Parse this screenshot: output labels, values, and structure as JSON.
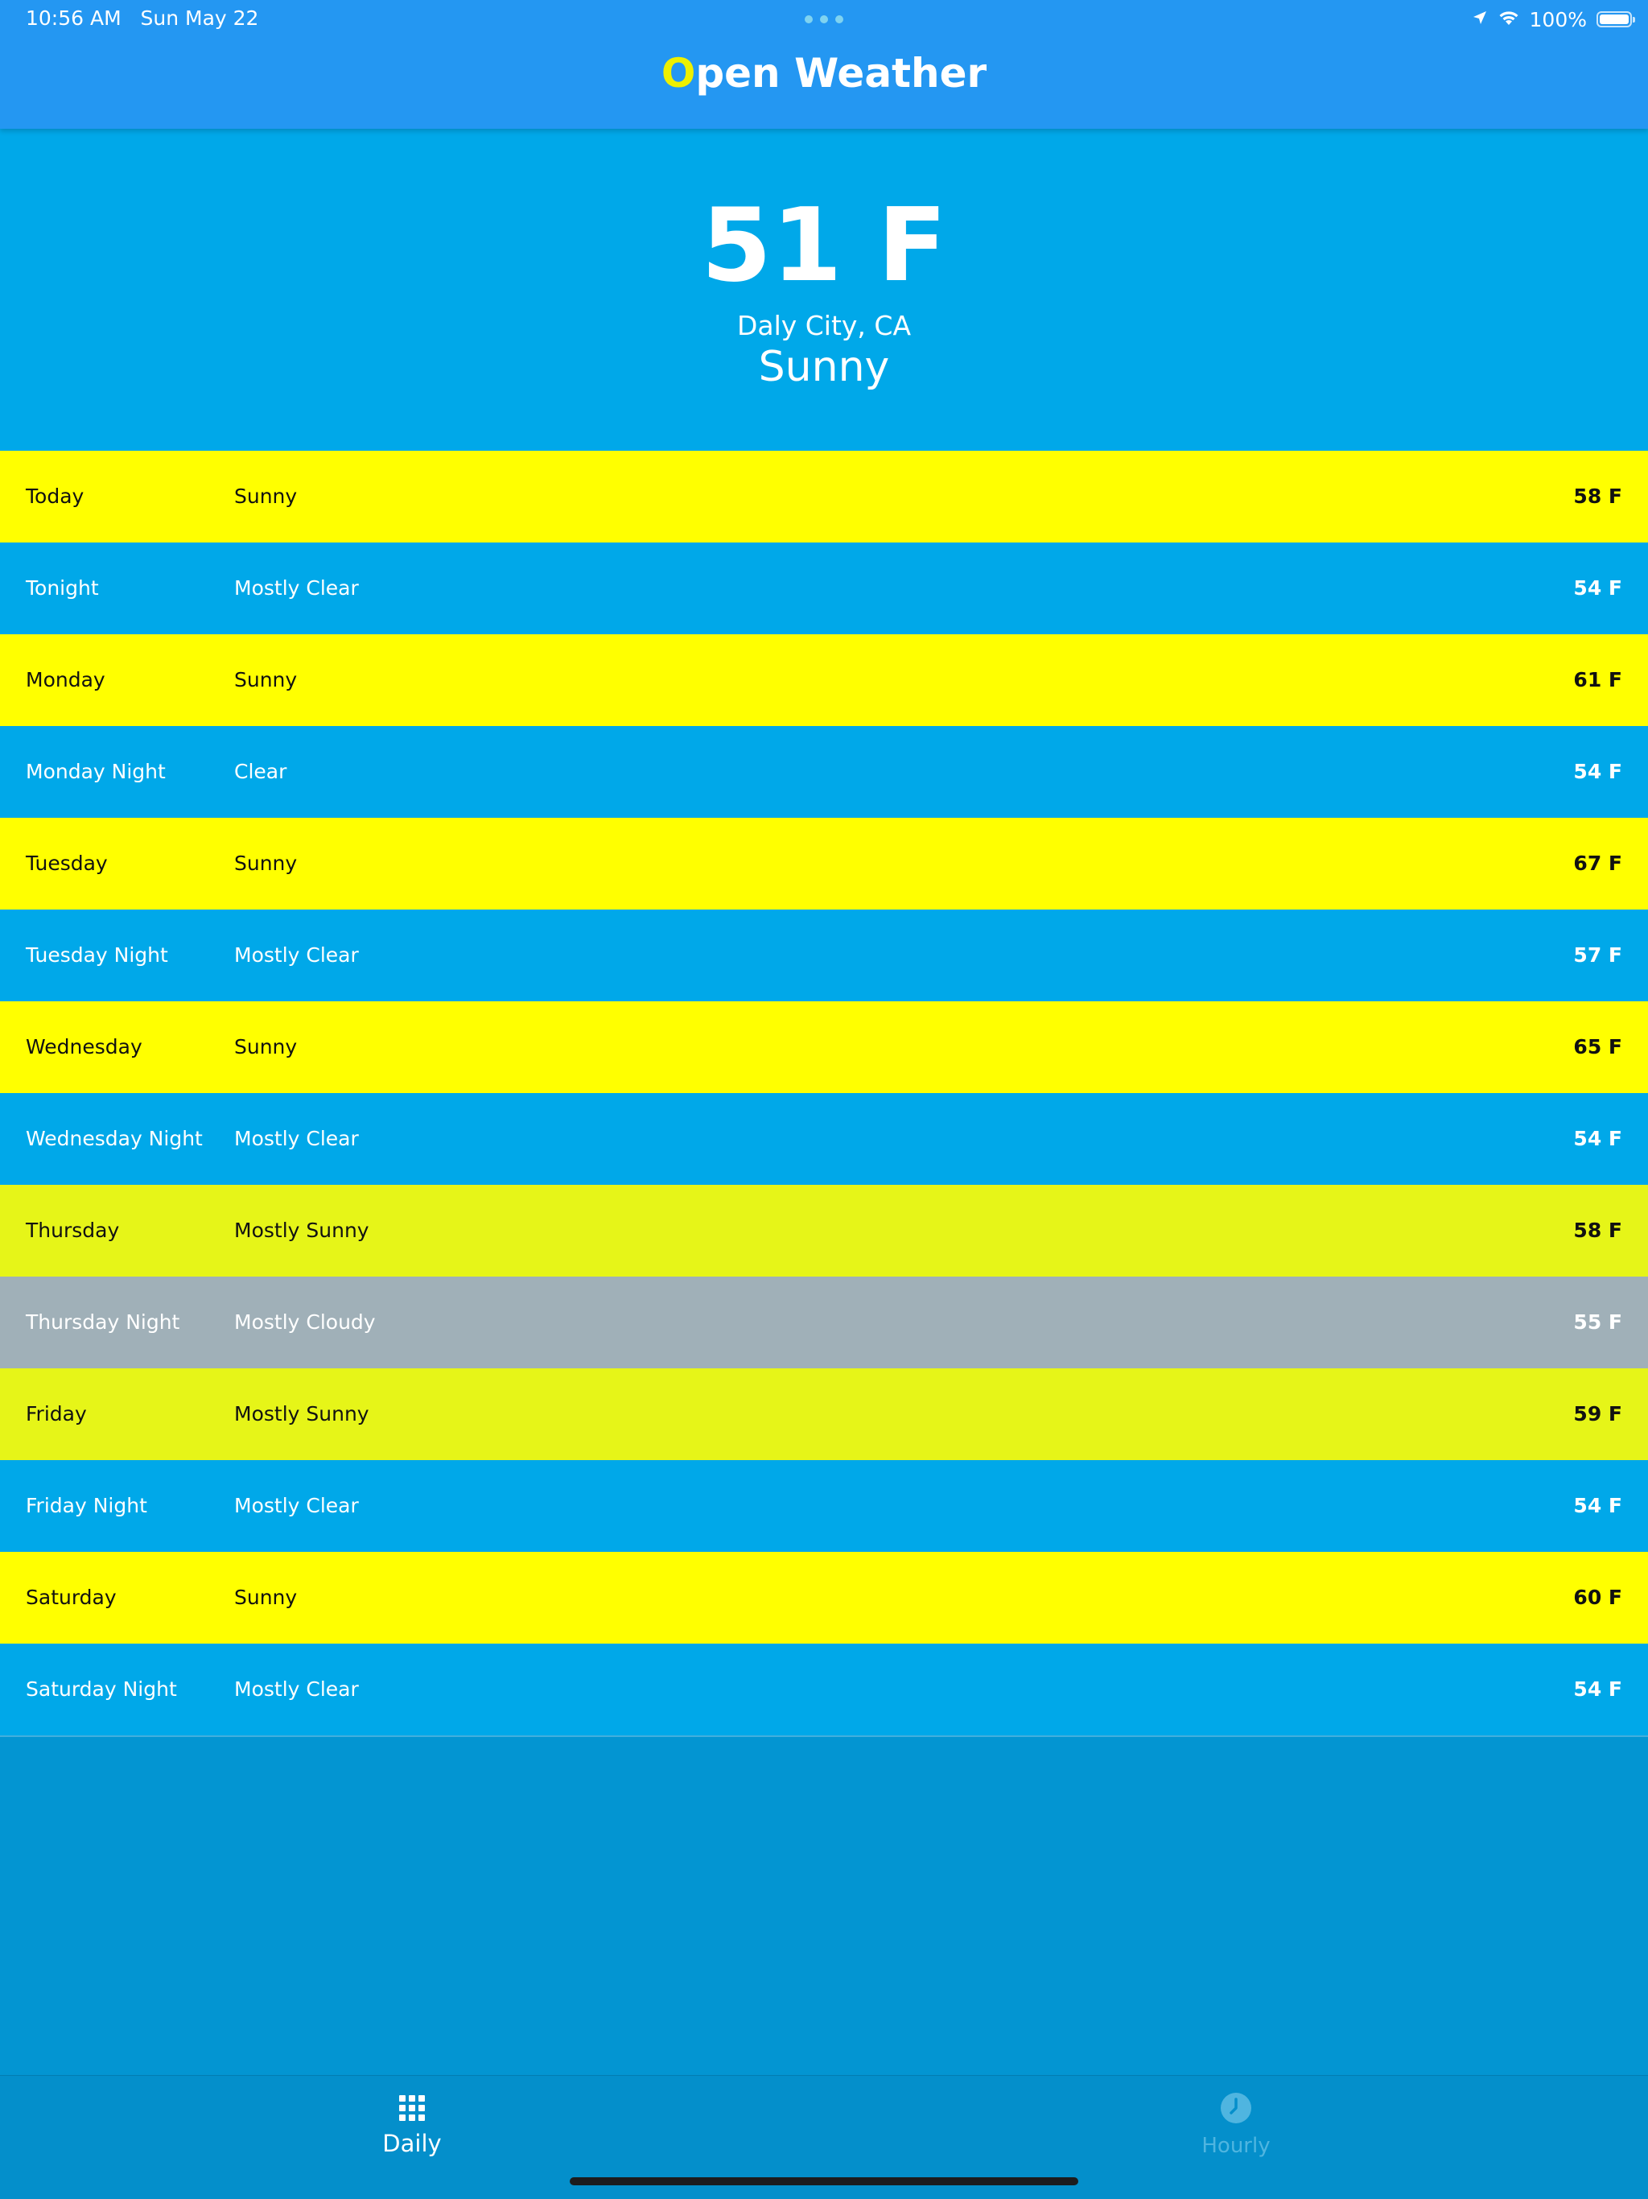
{
  "status_bar": {
    "time": "10:56 AM   Sun May 22",
    "battery": "100%"
  },
  "header": {
    "title_first_letter": "O",
    "title_rest": "pen Weather",
    "accent_color": "#eef000",
    "bar_color": "#2497f2"
  },
  "current": {
    "temperature": "51 F",
    "location": "Daly City, CA",
    "condition": "Sunny"
  },
  "forecast": [
    {
      "period": "Today",
      "condition": "Sunny",
      "temp": "58 F",
      "bg": "#ffff00",
      "fg": "#111111"
    },
    {
      "period": "Tonight",
      "condition": "Mostly Clear",
      "temp": "54 F",
      "bg": "#00a8e9",
      "fg": "#ffffff"
    },
    {
      "period": "Monday",
      "condition": "Sunny",
      "temp": "61 F",
      "bg": "#ffff00",
      "fg": "#111111"
    },
    {
      "period": "Monday Night",
      "condition": "Clear",
      "temp": "54 F",
      "bg": "#00a8e9",
      "fg": "#ffffff"
    },
    {
      "period": "Tuesday",
      "condition": "Sunny",
      "temp": "67 F",
      "bg": "#ffff00",
      "fg": "#111111"
    },
    {
      "period": "Tuesday Night",
      "condition": "Mostly Clear",
      "temp": "57 F",
      "bg": "#00a8e9",
      "fg": "#ffffff"
    },
    {
      "period": "Wednesday",
      "condition": "Sunny",
      "temp": "65 F",
      "bg": "#ffff00",
      "fg": "#111111"
    },
    {
      "period": "Wednesday Night",
      "condition": "Mostly Clear",
      "temp": "54 F",
      "bg": "#00a8e9",
      "fg": "#ffffff"
    },
    {
      "period": "Thursday",
      "condition": "Mostly Sunny",
      "temp": "58 F",
      "bg": "#e6f518",
      "fg": "#111111"
    },
    {
      "period": "Thursday Night",
      "condition": "Mostly Cloudy",
      "temp": "55 F",
      "bg": "#a0b0b8",
      "fg": "#ffffff"
    },
    {
      "period": "Friday",
      "condition": "Mostly Sunny",
      "temp": "59 F",
      "bg": "#e6f518",
      "fg": "#111111"
    },
    {
      "period": "Friday Night",
      "condition": "Mostly Clear",
      "temp": "54 F",
      "bg": "#00a8e9",
      "fg": "#ffffff"
    },
    {
      "period": "Saturday",
      "condition": "Sunny",
      "temp": "60 F",
      "bg": "#ffff00",
      "fg": "#111111"
    },
    {
      "period": "Saturday Night",
      "condition": "Mostly Clear",
      "temp": "54 F",
      "bg": "#00a8e9",
      "fg": "#ffffff"
    }
  ],
  "tabs": {
    "daily": {
      "label": "Daily",
      "icon": "grid-icon",
      "selected": true
    },
    "hourly": {
      "label": "Hourly",
      "icon": "clock-icon",
      "selected": false
    }
  }
}
